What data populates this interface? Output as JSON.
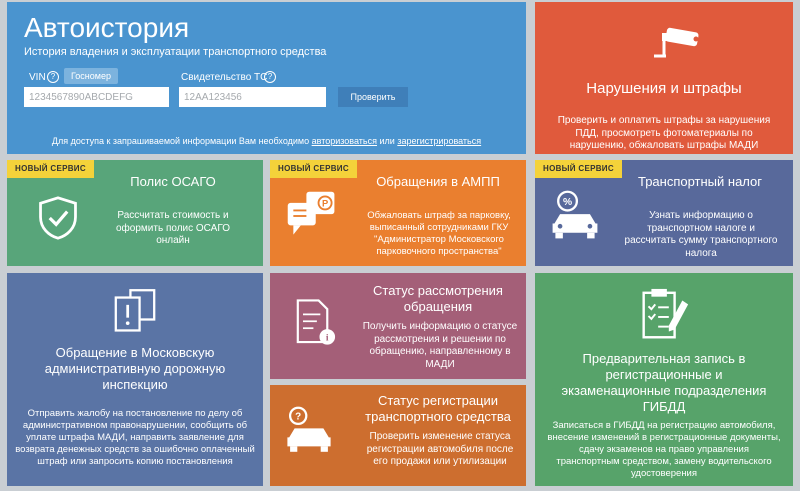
{
  "header": {
    "title": "Автоистория",
    "subtitle": "История владения и эксплуатации транспортного средства",
    "vin_label": "VIN",
    "help_glyph": "?",
    "gosnomer_label": "Госномер",
    "cert_label": "Свидетельство ТС",
    "vin_placeholder": "1234567890ABCDEFG",
    "cert_placeholder": "12АА123456",
    "check_button": "Проверить",
    "access_prefix": "Для доступа к запрашиваемой информации Вам необходимо",
    "login_link": "авторизоваться",
    "access_or": "или",
    "register_link": "зарегистрироваться"
  },
  "badge_text": "НОВЫЙ СЕРВИС",
  "tiles": {
    "violations": {
      "title": "Нарушения и штрафы",
      "desc": "Проверить и оплатить штрафы за нарушения ПДД, просмотреть фотоматериалы по нарушению, обжаловать штрафы МАДИ",
      "icon": "camera-icon"
    },
    "osago": {
      "title": "Полис ОСАГО",
      "desc": "Рассчитать стоимость и оформить полис ОСАГО онлайн",
      "icon": "shield-check-icon"
    },
    "ampp": {
      "title": "Обращения в АМПП",
      "desc": "Обжаловать штраф за парковку, выписанный сотрудниками ГКУ \"Администратор Московского парковочного пространства\"",
      "icon": "chat-parking-icon"
    },
    "tax": {
      "title": "Транспортный налог",
      "desc": "Узнать информацию о транспортном налоге и рассчитать сумму транспортного налога",
      "icon": "car-percent-icon"
    },
    "madi": {
      "title": "Обращение в Московскую административную дорожную инспекцию",
      "desc": "Отправить жалобу на постановление по делу об административном правонарушении, сообщить об уплате штрафа МАДИ, направить заявление для возврата денежных средств за ошибочно оплаченный штраф или запросить копию постановления",
      "icon": "document-alert-icon"
    },
    "status_appeal": {
      "title": "Статус рассмотрения обращения",
      "desc": "Получить информацию о статусе рассмотрения и решении по обращению, направленному в МАДИ",
      "icon": "document-info-icon"
    },
    "status_reg": {
      "title": "Статус регистрации транспортного средства",
      "desc": "Проверить изменение статуса регистрации автомобиля после его продажи или утилизации",
      "icon": "car-question-icon"
    },
    "gibdd": {
      "title": "Предварительная запись в регистрационные и экзаменационные подразделения ГИБДД",
      "desc": "Записаться в ГИБДД на регистрацию автомобиля, внесение изменений в регистрационные документы, сдачу экзаменов на право управления транспортным средством, замену водительского удостоверения",
      "icon": "clipboard-check-icon"
    }
  },
  "colors": {
    "header": "#4a94cf",
    "violations": "#e05a3c",
    "osago": "#58a57a",
    "ampp": "#ea7f2f",
    "tax": "#58699b",
    "madi": "#5a74a5",
    "status_appeal": "#a45f78",
    "status_reg": "#cd6e2f",
    "gibdd": "#57a36a",
    "badge": "#f4d23a"
  }
}
